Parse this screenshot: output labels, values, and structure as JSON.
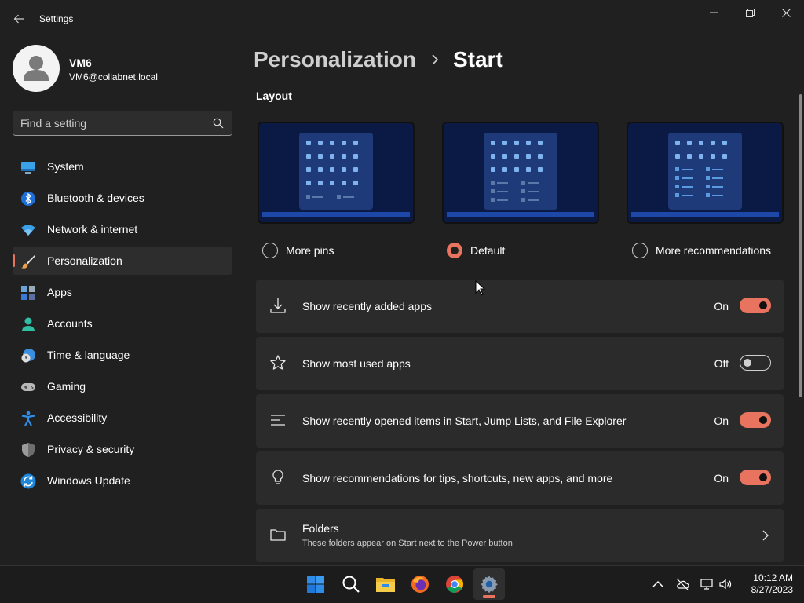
{
  "window": {
    "title": "Settings"
  },
  "user": {
    "name": "VM6",
    "email": "VM6@collabnet.local"
  },
  "search": {
    "placeholder": "Find a setting"
  },
  "nav": {
    "items": [
      {
        "label": "System",
        "icon": "monitor-icon"
      },
      {
        "label": "Bluetooth & devices",
        "icon": "bluetooth-icon"
      },
      {
        "label": "Network & internet",
        "icon": "wifi-icon"
      },
      {
        "label": "Personalization",
        "icon": "brush-icon",
        "selected": true
      },
      {
        "label": "Apps",
        "icon": "apps-icon"
      },
      {
        "label": "Accounts",
        "icon": "person-icon"
      },
      {
        "label": "Time & language",
        "icon": "globe-clock-icon"
      },
      {
        "label": "Gaming",
        "icon": "gamepad-icon"
      },
      {
        "label": "Accessibility",
        "icon": "accessibility-icon"
      },
      {
        "label": "Privacy & security",
        "icon": "shield-icon"
      },
      {
        "label": "Windows Update",
        "icon": "update-icon"
      }
    ]
  },
  "header": {
    "parent": "Personalization",
    "current": "Start"
  },
  "layout": {
    "title": "Layout",
    "options": [
      {
        "label": "More pins",
        "selected": false
      },
      {
        "label": "Default",
        "selected": true
      },
      {
        "label": "More recommendations",
        "selected": false
      }
    ]
  },
  "settings": [
    {
      "label": "Show recently added apps",
      "state": "On",
      "icon": "download-icon"
    },
    {
      "label": "Show most used apps",
      "state": "Off",
      "icon": "star-icon"
    },
    {
      "label": "Show recently opened items in Start, Jump Lists, and File Explorer",
      "state": "On",
      "icon": "list-icon"
    },
    {
      "label": "Show recommendations for tips, shortcuts, new apps, and more",
      "state": "On",
      "icon": "lightbulb-icon"
    }
  ],
  "folders": {
    "label": "Folders",
    "description": "These folders appear on Start next to the Power button"
  },
  "taskbar": {
    "apps": [
      "windows-start-icon",
      "search-icon",
      "file-explorer-icon",
      "firefox-icon",
      "chrome-icon",
      "settings-gear-icon"
    ],
    "tray": [
      "chevron-up-icon",
      "cloud-off-icon",
      "network-icon",
      "volume-icon"
    ],
    "time": "10:12 AM",
    "date": "8/27/2023"
  },
  "colors": {
    "accent": "#e8745f",
    "background": "#202020",
    "card": "#2b2b2b"
  }
}
